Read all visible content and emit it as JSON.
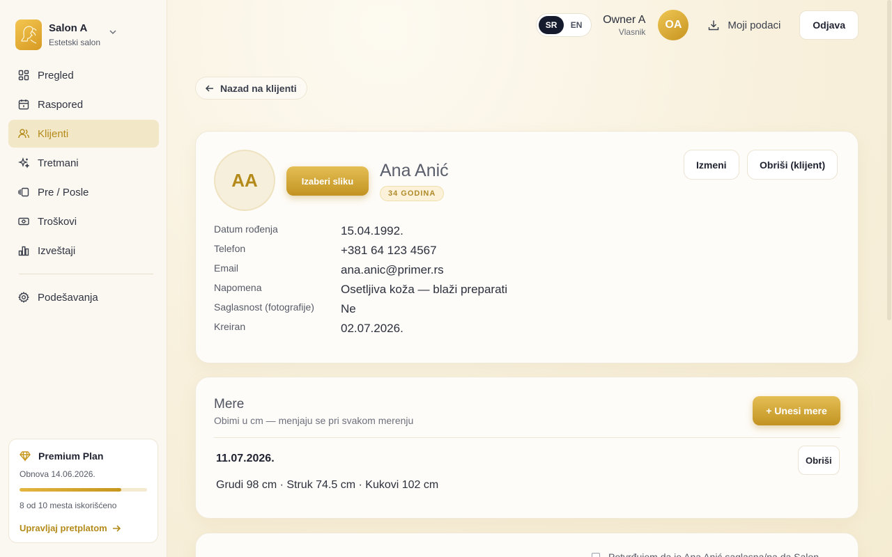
{
  "brand": {
    "name": "Salon A",
    "subtitle": "Estetski salon"
  },
  "nav": {
    "items": [
      {
        "label": "Pregled",
        "icon": "dashboard-icon"
      },
      {
        "label": "Raspored",
        "icon": "calendar-icon"
      },
      {
        "label": "Klijenti",
        "icon": "users-icon",
        "active": true
      },
      {
        "label": "Tretmani",
        "icon": "sparkles-icon"
      },
      {
        "label": "Pre / Posle",
        "icon": "before-after-icon"
      },
      {
        "label": "Troškovi",
        "icon": "cash-icon"
      },
      {
        "label": "Izveštaji",
        "icon": "bar-chart-icon"
      }
    ],
    "settings_label": "Podešavanja"
  },
  "plan": {
    "title": "Premium Plan",
    "renewal": "Obnova 14.06.2026.",
    "usage_text": "8 od 10 mesta iskorišćeno",
    "usage_fraction": 0.8,
    "manage_link": "Upravljaj pretplatom"
  },
  "topbar": {
    "lang_options": [
      "SR",
      "EN"
    ],
    "lang_selected": "SR",
    "owner_name": "Owner A",
    "owner_role": "Vlasnik",
    "avatar_initials": "OA",
    "my_data_label": "Moji podaci",
    "logout_label": "Odjava"
  },
  "back_label": "Nazad na klijenti",
  "client": {
    "initials": "AA",
    "pick_photo_label": "Izaberi sliku",
    "name": "Ana Anić",
    "age_badge": "34 GODINA",
    "edit_label": "Izmeni",
    "delete_label": "Obriši (klijent)",
    "details": [
      {
        "label": "Datum rođenja",
        "value": "15.04.1992."
      },
      {
        "label": "Telefon",
        "value": "+381 64 123 4567"
      },
      {
        "label": "Email",
        "value": "ana.anic@primer.rs"
      },
      {
        "label": "Napomena",
        "value": "Osetljiva koža — blaži preparati"
      },
      {
        "label": "Saglasnost (fotografije)",
        "value": "Ne"
      },
      {
        "label": "Kreiran",
        "value": "02.07.2026."
      }
    ]
  },
  "measures": {
    "title": "Mere",
    "subtitle": "Obimi u cm — menjaju se pri svakom merenju",
    "add_label": "+ Unesi mere",
    "entries": [
      {
        "date": "11.07.2026.",
        "values": "Grudi 98 cm · Struk 74.5 cm · Kukovi 102 cm",
        "delete_label": "Obriši"
      }
    ]
  },
  "consent_text": "Potvrđujem da je Ana Anić saglasna/na da  Salon",
  "colors": {
    "accent": "#c6961d",
    "active_nav_bg": "#f2e7c6",
    "dark": "#151b2c"
  }
}
